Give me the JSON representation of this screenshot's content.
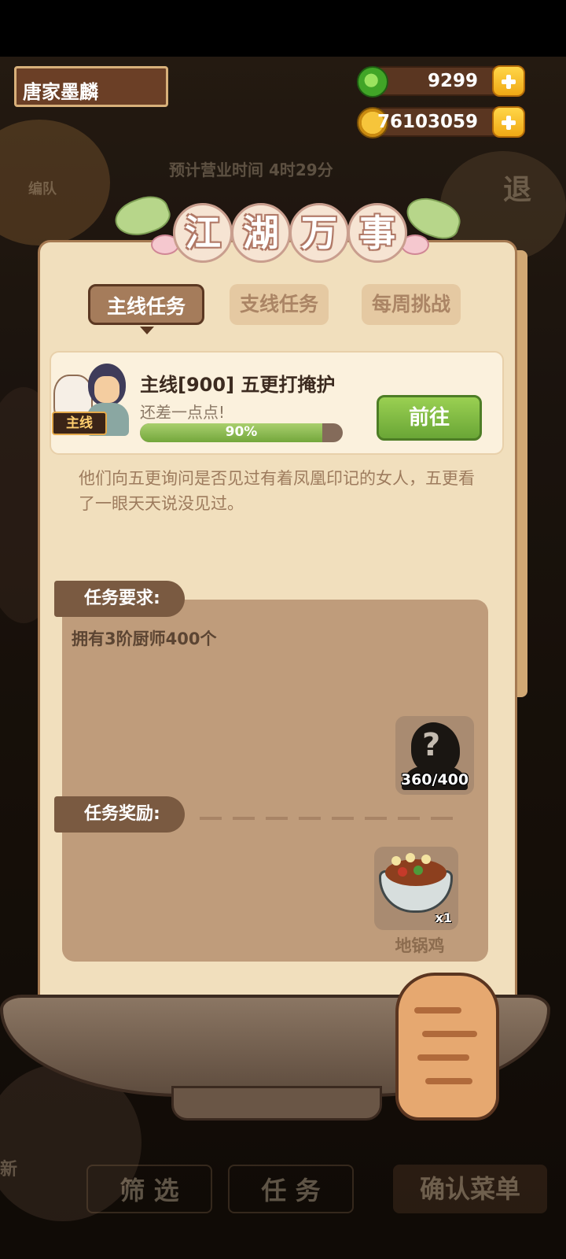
{
  "player": {
    "name": "唐家墨麟"
  },
  "currency": {
    "jade": "9299",
    "coins": "76103059"
  },
  "background": {
    "business_time": "预计营业时间  4时29分",
    "team_label": "编队",
    "exit_label": "退",
    "filter_label": "筛  选",
    "task_label": "任  务",
    "confirm_label": "确认菜单",
    "new_label": "新"
  },
  "panel": {
    "title_chars": [
      "江",
      "湖",
      "万",
      "事"
    ],
    "tabs": [
      {
        "label": "主线任务",
        "active": true
      },
      {
        "label": "支线任务",
        "active": false
      },
      {
        "label": "每周挑战",
        "active": false
      }
    ],
    "quest": {
      "badge": "主线",
      "title": "主线[900] 五更打掩护",
      "subtitle": "还差一点点!",
      "progress": 0.9,
      "progress_text": "90%",
      "go_label": "前往"
    },
    "description": "他们向五更询问是否见过有着凤凰印记的女人，五更看了一眼天天说没见过。",
    "requirement": {
      "heading": "任务要求:",
      "text": "拥有3阶厨师400个",
      "count": "360/400"
    },
    "reward": {
      "heading": "任务奖励:",
      "item_name": "地锅鸡",
      "quantity": "x1"
    }
  },
  "colors": {
    "accent_green": "#73a73c",
    "panel": "#f1dfbd",
    "tab_active": "#a57c5b"
  }
}
